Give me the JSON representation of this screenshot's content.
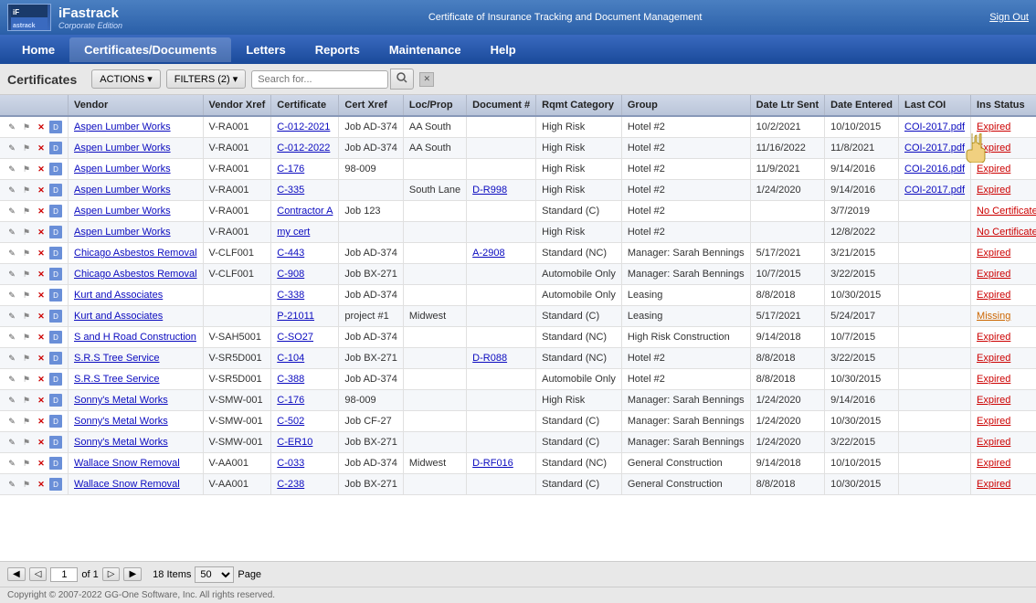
{
  "app": {
    "name": "iFastrack",
    "edition": "Corporate Edition",
    "description": "Certificate of Insurance Tracking and Document Management",
    "sign_out": "Sign Out"
  },
  "nav": {
    "items": [
      "Home",
      "Certificates/Documents",
      "Letters",
      "Reports",
      "Maintenance",
      "Help"
    ],
    "active": "Certificates/Documents"
  },
  "toolbar": {
    "page_title": "Certificates",
    "actions_btn": "ACTIONS ▾",
    "filters_btn": "FILTERS (2) ▾",
    "search_placeholder": "Search for..."
  },
  "table": {
    "columns": [
      "",
      "Vendor",
      "Vendor Xref",
      "Certificate",
      "Cert Xref",
      "Loc/Prop",
      "Document #",
      "Rqmt Category",
      "Group",
      "Date Ltr Sent",
      "Date Entered",
      "Last COI",
      "Ins Status"
    ],
    "rows": [
      {
        "vendor": "Aspen Lumber Works",
        "vendor_xref": "V-RA001",
        "certificate": "C-012-2021",
        "cert_xref": "Job AD-374",
        "loc_prop": "AA South",
        "document": "",
        "rqmt_category": "High Risk",
        "group": "Hotel #2",
        "date_ltr_sent": "10/2/2021",
        "date_entered": "10/10/2015",
        "last_coi": "COI-2017.pdf",
        "ins_status": "Expired"
      },
      {
        "vendor": "Aspen Lumber Works",
        "vendor_xref": "V-RA001",
        "certificate": "C-012-2022",
        "cert_xref": "Job AD-374",
        "loc_prop": "AA South",
        "document": "",
        "rqmt_category": "High Risk",
        "group": "Hotel #2",
        "date_ltr_sent": "11/16/2022",
        "date_entered": "11/8/2021",
        "last_coi": "COI-2017.pdf",
        "ins_status": "Expired"
      },
      {
        "vendor": "Aspen Lumber Works",
        "vendor_xref": "V-RA001",
        "certificate": "C-176",
        "cert_xref": "98-009",
        "loc_prop": "",
        "document": "",
        "rqmt_category": "High Risk",
        "group": "Hotel #2",
        "date_ltr_sent": "11/9/2021",
        "date_entered": "9/14/2016",
        "last_coi": "COI-2016.pdf",
        "ins_status": "Expired"
      },
      {
        "vendor": "Aspen Lumber Works",
        "vendor_xref": "V-RA001",
        "certificate": "C-335",
        "cert_xref": "",
        "loc_prop": "South Lane",
        "document": "D-R998",
        "rqmt_category": "High Risk",
        "group": "Hotel #2",
        "date_ltr_sent": "1/24/2020",
        "date_entered": "9/14/2016",
        "last_coi": "COI-2017.pdf",
        "ins_status": "Expired"
      },
      {
        "vendor": "Aspen Lumber Works",
        "vendor_xref": "V-RA001",
        "certificate": "Contractor A",
        "cert_xref": "Job 123",
        "loc_prop": "",
        "document": "",
        "rqmt_category": "Standard (C)",
        "group": "Hotel #2",
        "date_ltr_sent": "",
        "date_entered": "3/7/2019",
        "last_coi": "",
        "ins_status": "No Certificate"
      },
      {
        "vendor": "Aspen Lumber Works",
        "vendor_xref": "V-RA001",
        "certificate": "my cert",
        "cert_xref": "",
        "loc_prop": "",
        "document": "",
        "rqmt_category": "High Risk",
        "group": "Hotel #2",
        "date_ltr_sent": "",
        "date_entered": "12/8/2022",
        "last_coi": "",
        "ins_status": "No Certificate"
      },
      {
        "vendor": "Chicago Asbestos Removal",
        "vendor_xref": "V-CLF001",
        "certificate": "C-443",
        "cert_xref": "Job AD-374",
        "loc_prop": "",
        "document": "A-2908",
        "rqmt_category": "Standard (NC)",
        "group": "Manager: Sarah Bennings",
        "date_ltr_sent": "5/17/2021",
        "date_entered": "3/21/2015",
        "last_coi": "",
        "ins_status": "Expired"
      },
      {
        "vendor": "Chicago Asbestos Removal",
        "vendor_xref": "V-CLF001",
        "certificate": "C-908",
        "cert_xref": "Job BX-271",
        "loc_prop": "",
        "document": "",
        "rqmt_category": "Automobile Only",
        "group": "Manager: Sarah Bennings",
        "date_ltr_sent": "10/7/2015",
        "date_entered": "3/22/2015",
        "last_coi": "",
        "ins_status": "Expired"
      },
      {
        "vendor": "Kurt and Associates",
        "vendor_xref": "",
        "certificate": "C-338",
        "cert_xref": "Job AD-374",
        "loc_prop": "",
        "document": "",
        "rqmt_category": "Automobile Only",
        "group": "Leasing",
        "date_ltr_sent": "8/8/2018",
        "date_entered": "10/30/2015",
        "last_coi": "",
        "ins_status": "Expired"
      },
      {
        "vendor": "Kurt and Associates",
        "vendor_xref": "",
        "certificate": "P-21011",
        "cert_xref": "project #1",
        "loc_prop": "Midwest",
        "document": "",
        "rqmt_category": "Standard (C)",
        "group": "Leasing",
        "date_ltr_sent": "5/17/2021",
        "date_entered": "5/24/2017",
        "last_coi": "",
        "ins_status": "Missing"
      },
      {
        "vendor": "S and H Road Construction",
        "vendor_xref": "V-SAH5001",
        "certificate": "C-SO27",
        "cert_xref": "Job AD-374",
        "loc_prop": "",
        "document": "",
        "rqmt_category": "Standard (NC)",
        "group": "High Risk Construction",
        "date_ltr_sent": "9/14/2018",
        "date_entered": "10/7/2015",
        "last_coi": "",
        "ins_status": "Expired"
      },
      {
        "vendor": "S.R.S Tree Service",
        "vendor_xref": "V-SR5D001",
        "certificate": "C-104",
        "cert_xref": "Job BX-271",
        "loc_prop": "",
        "document": "D-R088",
        "rqmt_category": "Standard (NC)",
        "group": "Hotel #2",
        "date_ltr_sent": "8/8/2018",
        "date_entered": "3/22/2015",
        "last_coi": "",
        "ins_status": "Expired"
      },
      {
        "vendor": "S.R.S Tree Service",
        "vendor_xref": "V-SR5D001",
        "certificate": "C-388",
        "cert_xref": "Job AD-374",
        "loc_prop": "",
        "document": "",
        "rqmt_category": "Automobile Only",
        "group": "Hotel #2",
        "date_ltr_sent": "8/8/2018",
        "date_entered": "10/30/2015",
        "last_coi": "",
        "ins_status": "Expired"
      },
      {
        "vendor": "Sonny's Metal Works",
        "vendor_xref": "V-SMW-001",
        "certificate": "C-176",
        "cert_xref": "98-009",
        "loc_prop": "",
        "document": "",
        "rqmt_category": "High Risk",
        "group": "Manager: Sarah Bennings",
        "date_ltr_sent": "1/24/2020",
        "date_entered": "9/14/2016",
        "last_coi": "",
        "ins_status": "Expired"
      },
      {
        "vendor": "Sonny's Metal Works",
        "vendor_xref": "V-SMW-001",
        "certificate": "C-502",
        "cert_xref": "Job CF-27",
        "loc_prop": "",
        "document": "",
        "rqmt_category": "Standard (C)",
        "group": "Manager: Sarah Bennings",
        "date_ltr_sent": "1/24/2020",
        "date_entered": "10/30/2015",
        "last_coi": "",
        "ins_status": "Expired"
      },
      {
        "vendor": "Sonny's Metal Works",
        "vendor_xref": "V-SMW-001",
        "certificate": "C-ER10",
        "cert_xref": "Job BX-271",
        "loc_prop": "",
        "document": "",
        "rqmt_category": "Standard (C)",
        "group": "Manager: Sarah Bennings",
        "date_ltr_sent": "1/24/2020",
        "date_entered": "3/22/2015",
        "last_coi": "",
        "ins_status": "Expired"
      },
      {
        "vendor": "Wallace Snow Removal",
        "vendor_xref": "V-AA001",
        "certificate": "C-033",
        "cert_xref": "Job AD-374",
        "loc_prop": "Midwest",
        "document": "D-RF016",
        "rqmt_category": "Standard (NC)",
        "group": "General Construction",
        "date_ltr_sent": "9/14/2018",
        "date_entered": "10/10/2015",
        "last_coi": "",
        "ins_status": "Expired"
      },
      {
        "vendor": "Wallace Snow Removal",
        "vendor_xref": "V-AA001",
        "certificate": "C-238",
        "cert_xref": "Job BX-271",
        "loc_prop": "",
        "document": "",
        "rqmt_category": "Standard (C)",
        "group": "General Construction",
        "date_ltr_sent": "8/8/2018",
        "date_entered": "10/30/2015",
        "last_coi": "",
        "ins_status": "Expired"
      }
    ]
  },
  "pagination": {
    "current_page": "1",
    "total_pages": "of 1",
    "total_items": "18 Items",
    "per_page": "50",
    "page_label": "Page",
    "nav_first": "◀",
    "nav_prev": "◁",
    "nav_next": "▷",
    "nav_last": "▶"
  },
  "footer": {
    "copyright": "Copyright © 2007-2022 GG-One Software, Inc. All rights reserved."
  }
}
